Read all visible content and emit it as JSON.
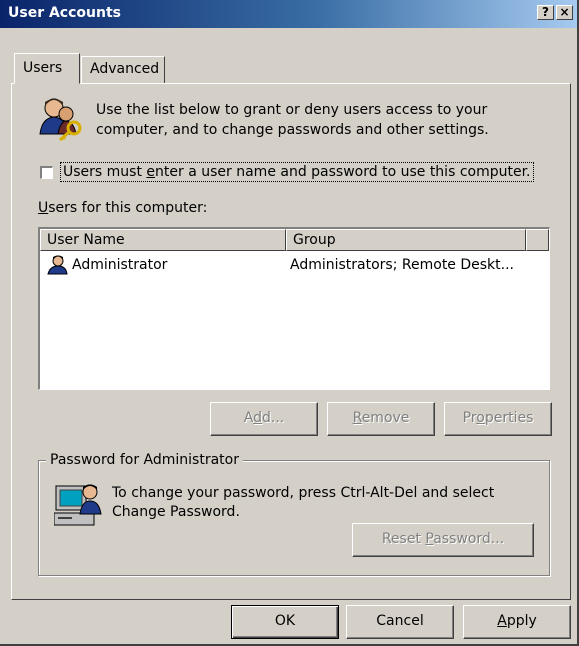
{
  "window": {
    "title": "User Accounts",
    "help_glyph": "?",
    "close_glyph": "×"
  },
  "tabs": [
    {
      "label": "Users",
      "active": true
    },
    {
      "label": "Advanced",
      "active": false
    }
  ],
  "intro": {
    "icon": "users-key-icon",
    "text": "Use the list below to grant or deny users access to your computer, and to change passwords and other settings."
  },
  "require_login": {
    "checked": false,
    "label_accel": "e",
    "label_pre": "Users must ",
    "label_post": "nter a user name and password to use this computer."
  },
  "users_section": {
    "label_accel": "U",
    "label_rest": "sers for this computer:",
    "columns": [
      "User Name",
      "Group"
    ],
    "rows": [
      {
        "icon": "user-icon",
        "name": "Administrator",
        "group": "Administrators; Remote Deskt..."
      }
    ]
  },
  "user_buttons": {
    "add": {
      "pre": "A",
      "accel": "d",
      "post": "d...",
      "enabled": false
    },
    "remove": {
      "pre": "",
      "accel": "R",
      "post": "emove",
      "enabled": false
    },
    "properties": {
      "pre": "Pr",
      "accel": "o",
      "post": "perties",
      "enabled": false
    }
  },
  "password_group": {
    "title": "Password for Administrator",
    "icon": "computer-user-icon",
    "text": "To change your password, press Ctrl-Alt-Del and select Change Password.",
    "reset_button": {
      "pre": "Reset ",
      "accel": "P",
      "post": "assword...",
      "enabled": false
    }
  },
  "footer": {
    "ok": "OK",
    "cancel": "Cancel",
    "apply_accel": "A",
    "apply_rest": "pply"
  },
  "colors": {
    "face": "#d4d0c8",
    "title_start": "#0a246a",
    "title_end": "#a6caf0",
    "disabled_text": "#808080"
  }
}
